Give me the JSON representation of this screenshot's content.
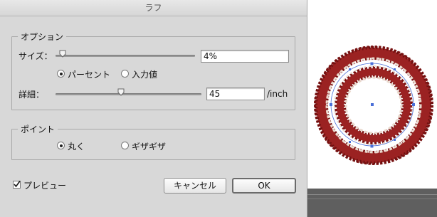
{
  "dialog": {
    "title": "ラフ"
  },
  "options": {
    "legend": "オプション",
    "size": {
      "label": "サイズ：",
      "value": "4%",
      "slider_fraction": 0.05
    },
    "units": {
      "percent_label": "パーセント",
      "absolute_label": "入力値",
      "selected": "percent"
    },
    "detail": {
      "label": "詳細：",
      "value": "45",
      "unit": "/inch",
      "slider_fraction": 0.45
    }
  },
  "points": {
    "legend": "ポイント",
    "smooth_label": "丸く",
    "corner_label": "ギザギザ",
    "selected": "smooth"
  },
  "preview": {
    "label": "プレビュー",
    "checked": true
  },
  "buttons": {
    "cancel": "キャンセル",
    "ok": "OK"
  },
  "colors": {
    "dialog_bg": "#d8d8d8",
    "artwork_fill": "#8b1a1a",
    "selection_path": "#4a6fd8"
  },
  "icons": {
    "slider_thumb": "triangle-down-thumb-icon",
    "radio_selected": "radio-dot-icon",
    "checkbox_checked": "checkmark-icon"
  }
}
